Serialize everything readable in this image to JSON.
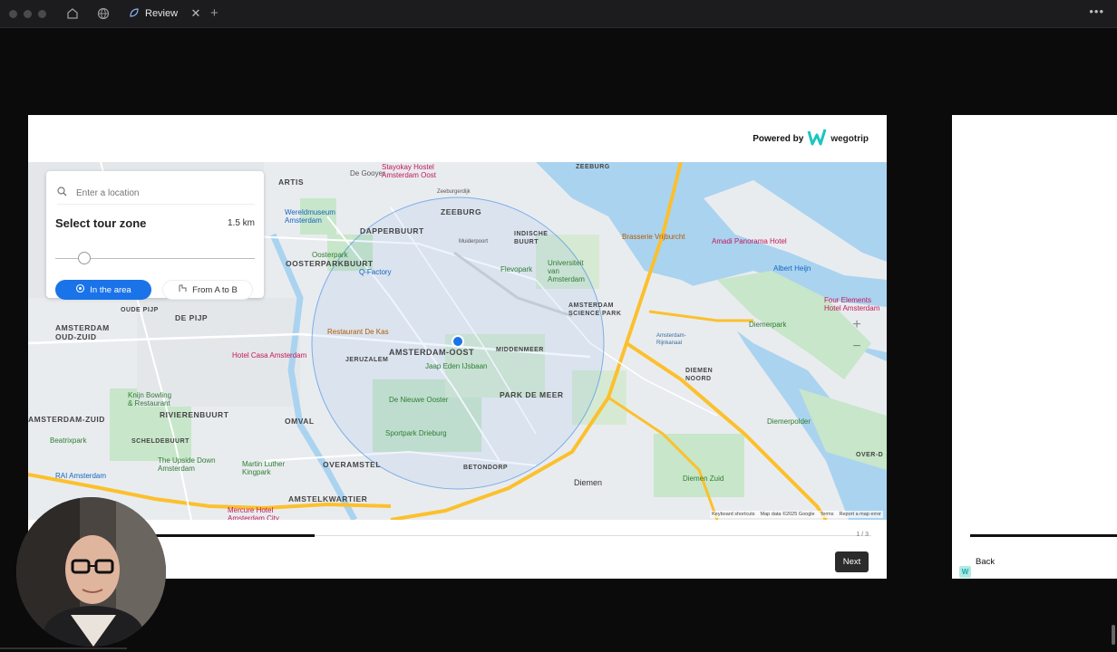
{
  "window": {
    "tab_title": "Review",
    "tab_icon": "leaf-icon",
    "new_tab": "+",
    "more": "•••"
  },
  "card": {
    "powered_label": "Powered by",
    "brand": "wegotrip"
  },
  "panel": {
    "search_placeholder": "Enter a location",
    "title": "Select tour zone",
    "radius": "1.5 km",
    "radius_level": 0.12,
    "mode_in_area": "In the area",
    "mode_a_to_b": "From A to B"
  },
  "map": {
    "labels": {
      "zeeburg": "ZEEBURG",
      "dapperbuurt": "DAPPERBUURT",
      "oosterparkbuurt": "OOSTERPARKBUURT",
      "amsterdam_oost": "AMSTERDAM-OOST",
      "de_pijp": "DE PIJP",
      "oude_pijp": "OUDE PIJP",
      "amsterdam_oud_zuid": "AMSTERDAM\nOUD-ZUID",
      "jeruzalem": "JERUZALEM",
      "middenmeer": "MIDDENMEER",
      "park_de_meer": "PARK DE MEER",
      "omval": "OMVAL",
      "rivierenbuurt": "RIVIERENBUURT",
      "scheldebuurt": "SCHELDEBUURT",
      "amsterdam_zuid": "AMSTERDAM-ZUID",
      "overamstel": "OVERAMSTEL",
      "betondorp": "BETONDORP",
      "amstelkwartier": "AMSTELKWARTIER",
      "diemen": "Diemen",
      "diemen_noord": "DIEMEN\nNOORD",
      "diemerpolder": "Diemerpolder",
      "diemerpark": "Diemerpark",
      "diemen_zuid": "Diemen Zuid",
      "indische_buurt": "INDISCHE\nBUURT",
      "amsterdam_science_park": "AMSTERDAM\nSCIENCE PARK",
      "artis": "ARTIS",
      "de_gooyer": "De Gooyer",
      "stayokay": "Stayokay Hostel\nAmsterdam Oost",
      "wereldmuseum": "Wereldmuseum\nAmsterdam",
      "oosterpark": "Oosterpark",
      "q_factory": "Q-Factory",
      "flevopark": "Flevopark",
      "universiteit": "Universiteit\nvan\nAmsterdam",
      "restaurant_de_kas": "Restaurant De Kas",
      "hotel_casa": "Hotel Casa Amsterdam",
      "jaap_eden": "Jaap Eden IJsbaan",
      "de_nieuwe_ooster": "De Nieuwe Ooster",
      "sportpark_drieburg": "Sportpark Drieburg",
      "knijn_bowling": "Knijn Bowling\n& Restaurant",
      "beatrixpark": "Beatrixpark",
      "the_upside_down": "The Upside Down\nAmsterdam",
      "martin_luther": "Martin Luther\nKingpark",
      "rai": "RAI Amsterdam",
      "mercure": "Mercure Hotel\nAmsterdam City",
      "brasserie": "Brasserie Vrijburcht",
      "amadi": "Amadi Panorama Hotel",
      "albert_heijn": "Albert Heijn",
      "four_elements": "Four Elements\nHotel Amsterdam",
      "zeeburg_top": "ZEEBURG",
      "amsterdam_rijnkanaal": "Amsterdam-\nRijnkanaal",
      "over_d": "OVER-D",
      "zeeburgerdijk": "Zeeburgerdijk",
      "muiderpoort": "Muiderpoort"
    },
    "attribution": {
      "shortcuts": "Keyboard shortcuts",
      "data": "Map data ©2025 Google",
      "terms": "Terms",
      "report": "Report a map error"
    },
    "zoom_in": "+",
    "zoom_out": "−"
  },
  "footer": {
    "progress_count": "1 / 3",
    "progress_level": 0.25,
    "next": "Next"
  },
  "next_card": {
    "back": "Back",
    "badge": "W"
  },
  "colors": {
    "accent": "#1a73e8",
    "water": "#aad3f0",
    "park": "#c8e6c9",
    "road": "#fbc02d",
    "brand": "#19c6c0"
  }
}
